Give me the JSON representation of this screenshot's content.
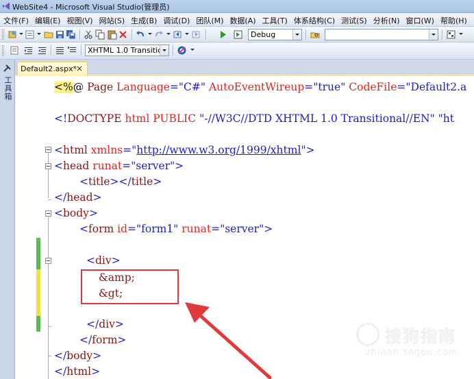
{
  "window": {
    "title": "WebSite4 - Microsoft Visual Studio(管理员)"
  },
  "menu": [
    "文件(F)",
    "编辑(E)",
    "视图(V)",
    "网站(S)",
    "生成(B)",
    "调试(D)",
    "团队(M)",
    "数据(A)",
    "工具(T)",
    "体系结构(C)",
    "测试(S)",
    "分析(N)",
    "窗口(W)",
    "帮助(H)"
  ],
  "toolbar": {
    "config_value": "Debug",
    "find_value": "",
    "schema_value": "XHTML 1.0 Transitic"
  },
  "sidebar": {
    "toolbox_label": "工具箱"
  },
  "tabs": {
    "active_label": "Default2.aspx*",
    "close_glyph": "×"
  },
  "code": {
    "l1_open": "<%",
    "l1_at": "@ ",
    "l1_page": "Page ",
    "l1_lang_attr": "Language",
    "l1_eq1": "=",
    "l1_lang_val": "\"C#\"",
    "l1_aew_attr": " AutoEventWireup",
    "l1_eq2": "=",
    "l1_aew_val": "\"true\"",
    "l1_cf_attr": " CodeFile",
    "l1_eq3": "=",
    "l1_cf_val": "\"Default2.a",
    "l2_doctype_open": "<!",
    "l2_doctype_kw": "DOCTYPE",
    "l2_doctype_rest": " html PUBLIC ",
    "l2_dtd": "\"-//W3C//DTD XHTML 1.0 Transitional//EN\"",
    "l2_tail": " \"ht",
    "l3_open": "<",
    "l3_tag": "html",
    "l3_attr": " xmlns",
    "l3_eq": "=",
    "l3_q1": "\"",
    "l3_url": "http://www.w3.org/1999/xhtml",
    "l3_q2": "\"",
    "l3_close": ">",
    "l4_open": "<",
    "l4_tag": "head",
    "l4_attr": " runat",
    "l4_eq": "=",
    "l4_val": "\"server\"",
    "l4_close": ">",
    "l5_a": "<",
    "l5_tag1": "title",
    "l5_b": "></",
    "l5_tag2": "title",
    "l5_c": ">",
    "l6_a": "</",
    "l6_tag": "head",
    "l6_c": ">",
    "l7_a": "<",
    "l7_tag": "body",
    "l7_c": ">",
    "l8_a": "<",
    "l8_tag": "form",
    "l8_attr1": " id",
    "l8_eq1": "=",
    "l8_val1": "\"form1\"",
    "l8_attr2": " runat",
    "l8_eq2": "=",
    "l8_val2": "\"server\"",
    "l8_c": ">",
    "l9_a": "<",
    "l9_tag": "div",
    "l9_c": ">",
    "l10_entity": "&amp;",
    "l11_entity": "&gt;",
    "l12_a": "</",
    "l12_tag": "div",
    "l12_c": ">",
    "l13_a": "</",
    "l13_tag": "form",
    "l13_c": ">",
    "l14_a": "</",
    "l14_tag": "body",
    "l14_c": ">",
    "l15_a": "</",
    "l15_tag": "html",
    "l15_c": ">"
  },
  "watermark": {
    "brand": "搜狗指南",
    "url": "zhinan.sogou.com"
  },
  "colors": {
    "highlight_box": "#e03a3a",
    "changed_line_green": "#5cbb4e",
    "changed_line_yellow": "#f0e040"
  }
}
